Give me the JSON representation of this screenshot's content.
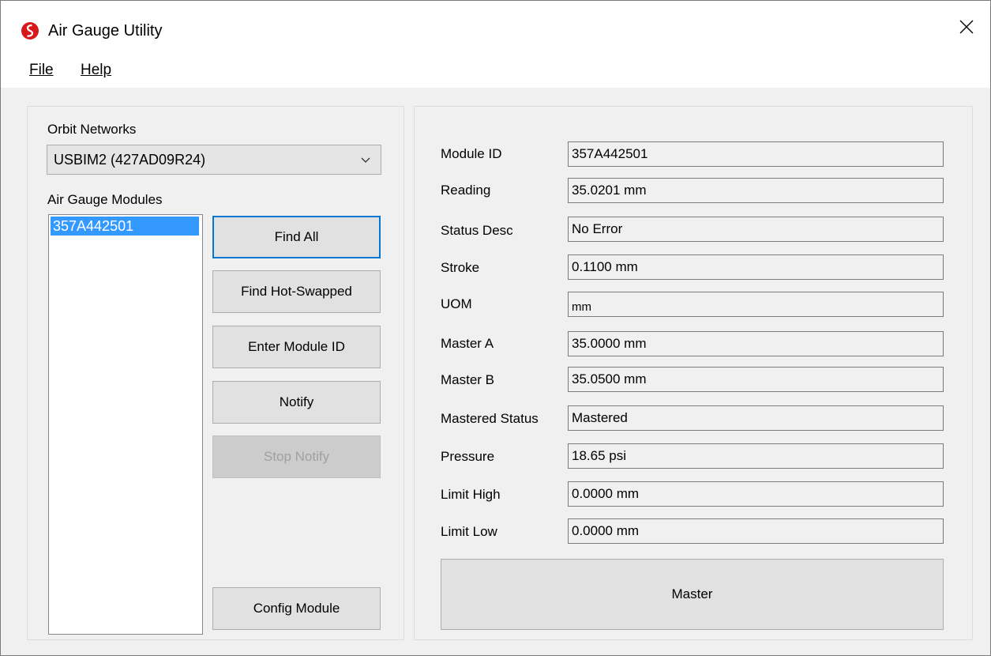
{
  "window": {
    "title": "Air Gauge Utility",
    "brand_color": "#d7191c"
  },
  "menu": {
    "file_label": "File",
    "help_label": "Help"
  },
  "left": {
    "networks_label": "Orbit Networks",
    "network_selected": "USBIM2 (427AD09R24)",
    "modules_label": "Air Gauge Modules",
    "modules": [
      "357A442501"
    ],
    "buttons": {
      "find_all": "Find All",
      "find_hot_swapped": "Find Hot-Swapped",
      "enter_module_id": "Enter Module ID",
      "notify": "Notify",
      "stop_notify": "Stop Notify",
      "config_module": "Config Module"
    }
  },
  "right": {
    "fields": [
      {
        "label": "Module ID",
        "value": "357A442501"
      },
      {
        "label": "Reading",
        "value": "35.0201 mm"
      },
      {
        "label": "Status Desc",
        "value": "No Error"
      },
      {
        "label": "Stroke",
        "value": "0.1100 mm"
      },
      {
        "label": "UOM",
        "value": "mm"
      },
      {
        "label": "Master A",
        "value": "35.0000 mm"
      },
      {
        "label": "Master B",
        "value": "35.0500 mm"
      },
      {
        "label": "Mastered Status",
        "value": "Mastered"
      },
      {
        "label": "Pressure",
        "value": "18.65 psi"
      },
      {
        "label": "Limit High",
        "value": "0.0000 mm"
      },
      {
        "label": "Limit Low",
        "value": "0.0000 mm"
      }
    ],
    "master_button": "Master"
  }
}
